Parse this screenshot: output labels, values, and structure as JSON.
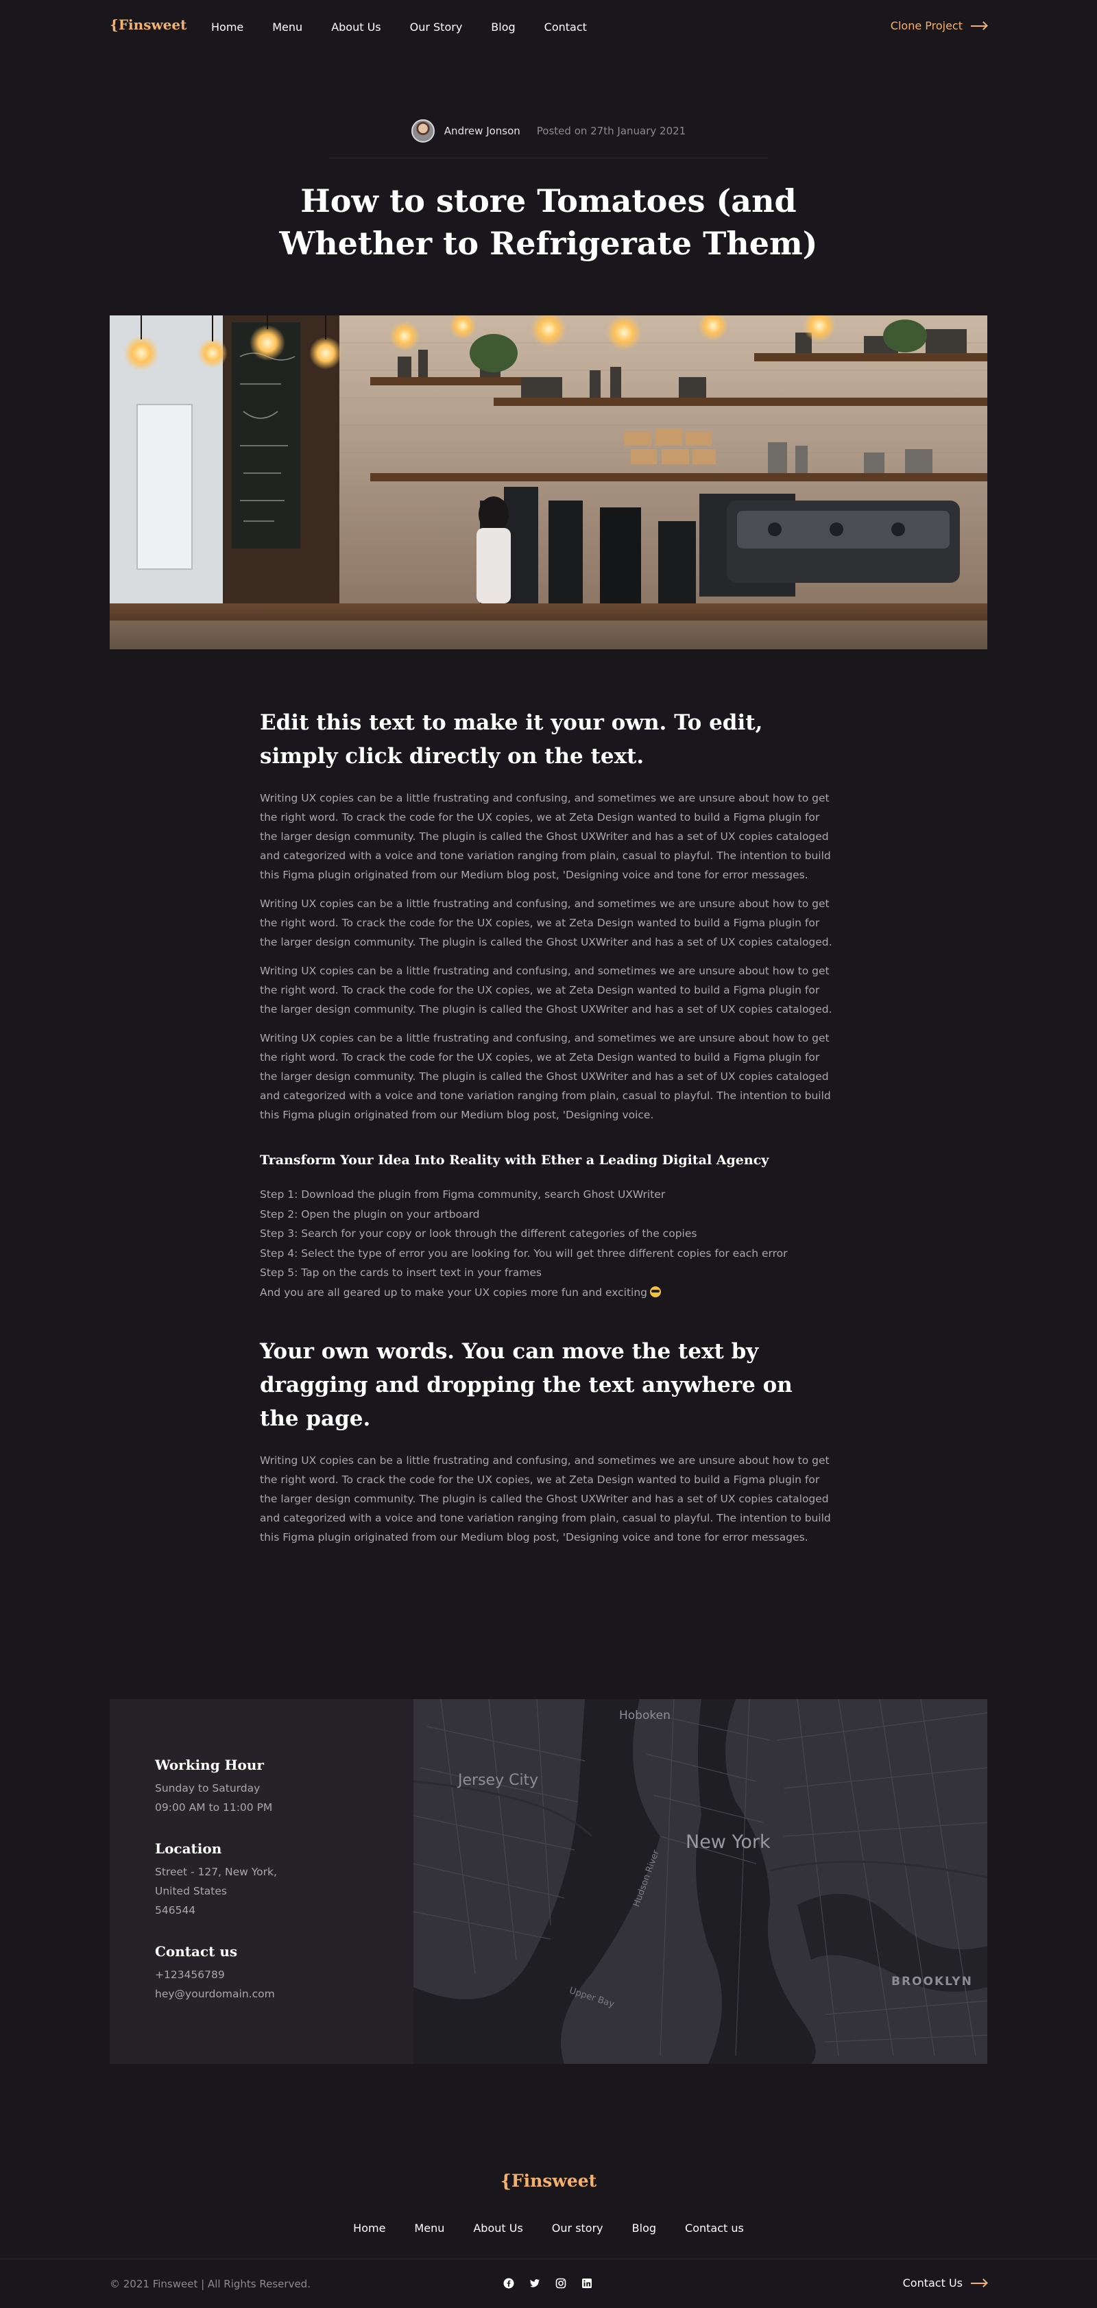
{
  "nav": {
    "logo": "{Finsweet",
    "links": [
      "Home",
      "Menu",
      "About Us",
      "Our Story",
      "Blog",
      "Contact"
    ],
    "cta": "Clone Project"
  },
  "post": {
    "author": "Andrew Jonson",
    "date": "Posted on 27th January 2021",
    "title": "How to store Tomatoes (and Whether to Refrigerate Them)"
  },
  "article": {
    "heading1": "Edit this text to make it your own. To edit, simply click directly on the text.",
    "paragraphs": [
      "Writing UX copies can be a little frustrating and confusing, and sometimes we are unsure about how to get the right word. To crack the code for the UX copies, we at Zeta Design wanted to build a Figma plugin for the larger design community. The plugin is called the Ghost UXWriter and has a set of UX copies cataloged and categorized with a voice and tone variation ranging from plain, casual to playful. The intention to build this Figma plugin originated from our Medium blog post, 'Designing voice and tone for error messages.",
      "Writing UX copies can be a little frustrating and confusing, and sometimes we are unsure about how to get the right word. To crack the code for the UX copies, we at Zeta Design wanted to build a Figma plugin for the larger design community. The plugin is called the Ghost UXWriter and has a set of UX copies cataloged.",
      "Writing UX copies can be a little frustrating and confusing, and sometimes we are unsure about how to get the right word. To crack the code for the UX copies, we at Zeta Design wanted to build a Figma plugin for the larger design community. The plugin is called the Ghost UXWriter and has a set of UX copies cataloged.",
      "Writing UX copies can be a little frustrating and confusing, and sometimes we are unsure about how to get the right word. To crack the code for the UX copies, we at Zeta Design wanted to build a Figma plugin for the larger design community. The plugin is called the Ghost UXWriter and has a set of UX copies cataloged and categorized with a voice and tone variation ranging from plain, casual to playful. The intention to build this Figma plugin originated from our Medium blog post, 'Designing voice."
    ],
    "heading2": "Transform Your Idea Into Reality with Ether a Leading Digital Agency",
    "steps": [
      "Step 1: Download the plugin from Figma community, search Ghost UXWriter",
      "Step 2: Open the plugin on your artboard",
      "Step 3: Search for your copy or look through the different categories of the copies",
      "Step 4: Select the type of error you are looking for. You will get three different copies for each error",
      "Step 5: Tap on the cards to insert text in your frames",
      "And you are all geared up to make your UX copies more fun and exciting"
    ],
    "heading3": "Your own words. You can move the text by dragging and dropping the text anywhere on the page.",
    "final_paragraph": "Writing UX copies can be a little frustrating and confusing, and sometimes we are unsure about how to get the right word. To crack the code for the UX copies, we at Zeta Design wanted to build a Figma plugin for the larger design community. The plugin is called the Ghost UXWriter and has a set of UX copies cataloged and categorized with a voice and tone variation ranging from plain, casual to playful. The intention to build this Figma plugin originated from our Medium blog post, 'Designing voice and tone for error messages."
  },
  "contact": {
    "hours_title": "Working Hour",
    "hours_days": "Sunday to Saturday",
    "hours_time": "09:00 AM to 11:00 PM",
    "location_title": "Location",
    "location_line1": "Street - 127, New York,",
    "location_line2": "United States",
    "location_line3": "546544",
    "contact_title": "Contact us",
    "phone": "+123456789",
    "email": "hey@yourdomain.com"
  },
  "map": {
    "labels": [
      "Hoboken",
      "Jersey City",
      "New York",
      "BROOKLYN",
      "Hudson River",
      "Upper Bay"
    ]
  },
  "footer": {
    "logo": "{Finsweet",
    "links": [
      "Home",
      "Menu",
      "About Us",
      "Our story",
      "Blog",
      "Contact us"
    ],
    "copyright": "© 2021 Finsweet | All Rights Reserved.",
    "cta": "Contact Us",
    "social_icons": [
      "facebook-icon",
      "twitter-icon",
      "instagram-icon",
      "linkedin-icon"
    ]
  },
  "colors": {
    "background": "#19171b",
    "accent": "#f4b16e",
    "card": "#252327"
  }
}
